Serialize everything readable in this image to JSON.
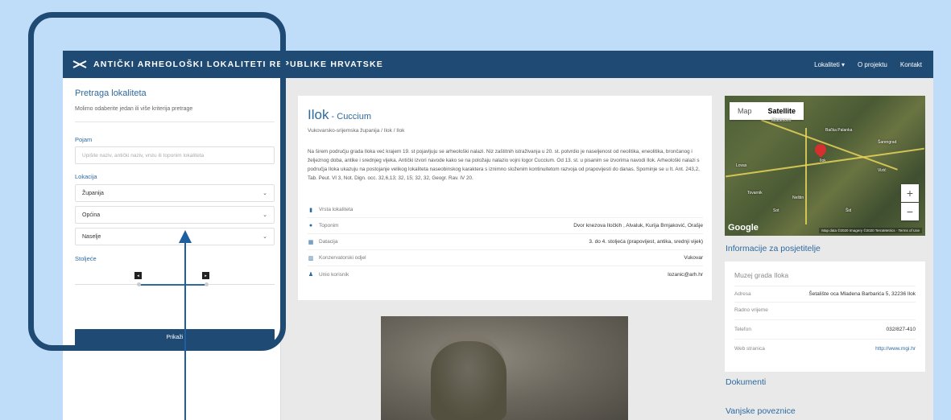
{
  "navbar": {
    "brand": "ANTIČKI ARHEOLOŠKI LOKALITETI REPUBLIKE HRVATSKE",
    "links": [
      "Lokaliteti ▾",
      "O projektu",
      "Kontakt"
    ]
  },
  "sidebar": {
    "title": "Pretraga lokaliteta",
    "subtitle": "Molimo odaberite jedan ili više kriterija pretrage",
    "pojam_label": "Pojam",
    "pojam_placeholder": "Upišite naziv, antički naziv, vrstu ili toponim lokaliteta",
    "lokacija_label": "Lokacija",
    "selects": [
      "Županija",
      "Općina",
      "Naselje"
    ],
    "stoljece_label": "Stoljeće",
    "slider_handles": [
      "◂",
      "▸"
    ],
    "search_button": "Prikaži"
  },
  "main": {
    "title": "Ilok",
    "title_sub": " - Cuccium",
    "breadcrumb": "Vukovarsko-srijemska županija / Ilok / Ilok",
    "description": "Na širem području grada Iloka već krajem 19. st pojavljuju se arheološki nalazi. Niz zaštitnih istraživanja u 20. st. potvrdio je naseljenost od neolitika, eneolitika, brončanog i željeznog doba, antike i srednjeg vijeka. Antički izvori navode kako se na položaju nalazio vojni logor Cuccium. Od 13. st. u pisanim se izvorima navodi Ilok. Arheološki nalazi s područja Iloka ukazuju na postojanje velikog lokaliteta naseobinskog karaktera s iznimno složenim kontinuitetom razvoja od prapovijesti do danas. Spominje se u It. Ant. 243,2, Tab. Peut. VI 3, Not. Dign. occ. 32,6,13; 32, 15; 32, 32, Geogr. Rav. IV 20.",
    "properties": [
      {
        "icon": "bookmark-icon",
        "glyph": "▮",
        "key": "Vrsta lokaliteta",
        "value": ""
      },
      {
        "icon": "map-marker-icon",
        "glyph": "●",
        "key": "Toponim",
        "value": "Dvor knezova Iločkih , Alvaluk, Kurija Brnjaković, Orašje"
      },
      {
        "icon": "calendar-icon",
        "glyph": "▦",
        "key": "Datacija",
        "value": "3. do 4. stoljeća (prapovijest, antika, srednji vijek)"
      },
      {
        "icon": "institution-icon",
        "glyph": "▥",
        "key": "Konzervatorski odjel",
        "value": "Vukovar"
      },
      {
        "icon": "user-icon",
        "glyph": "♟",
        "key": "Unio korisnik",
        "value": "lozanic@arh.hr"
      }
    ]
  },
  "map": {
    "tabs": [
      "Map",
      "Satellite"
    ],
    "active_tab": "Satellite",
    "zoom_in": "+",
    "zoom_out": "−",
    "google": "Google",
    "footer": "Map data ©2020 Imagery ©2020 TerraMetrics · Terms of Use",
    "labels": [
      "Mladenovo",
      "Bačka Palanka",
      "Ilok",
      "Lovas",
      "Šarengrad",
      "Tovarnik",
      "Neštin",
      "Vizić",
      "Sot",
      "Šid"
    ]
  },
  "visitor_info": {
    "section_title": "Informacije za posjetitelje",
    "heading": "Muzej grada Iloka",
    "rows": [
      {
        "key": "Adresa",
        "value": "Šetalište oca Mladena Barbarića 5, 32236 Ilok",
        "link": false
      },
      {
        "key": "Radno vrijeme",
        "value": "",
        "link": false
      },
      {
        "key": "Telefon",
        "value": "032/827-410",
        "link": false
      },
      {
        "key": "Web stranica",
        "value": "http://www.mgi.hr",
        "link": true
      }
    ]
  },
  "sections": {
    "dokumenti": "Dokumenti",
    "vanjske": "Vanjske poveznice"
  },
  "colors": {
    "navbar": "#1f4a74",
    "accent": "#2d6aa0",
    "background": "#bfdcf8"
  }
}
